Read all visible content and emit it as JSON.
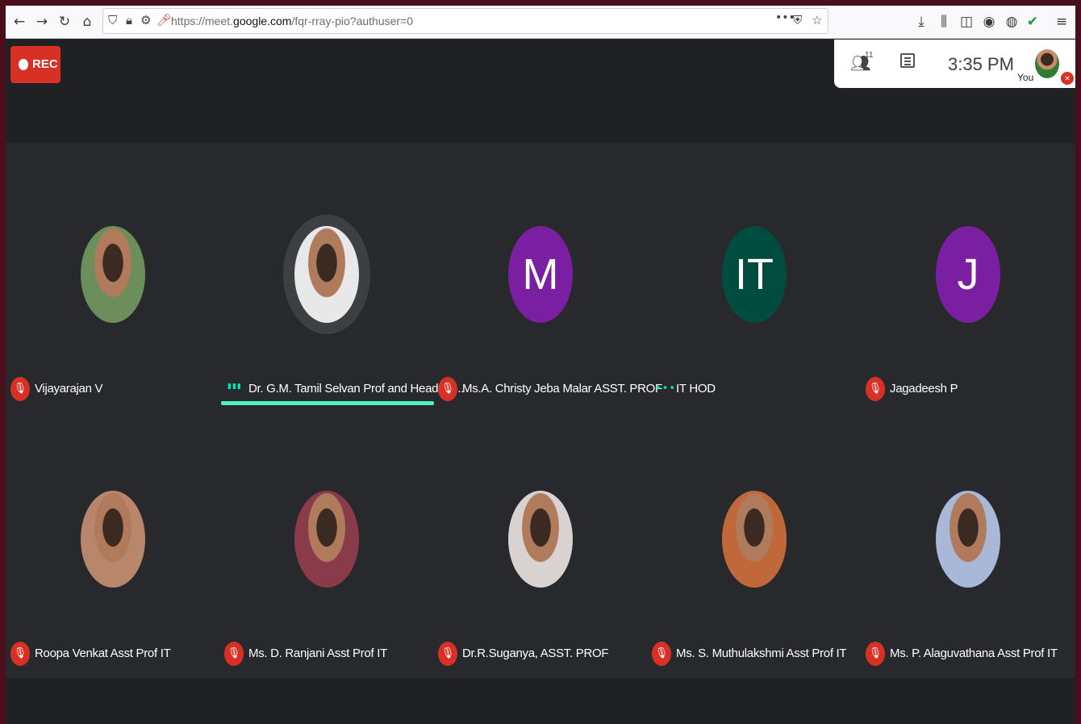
{
  "browser": {
    "url_prefix": "https://meet.",
    "url_domain": "google.com",
    "url_path": "/fqr-rray-pio?authuser=0",
    "url_more": "•••"
  },
  "meeting": {
    "rec_label": "REC",
    "people_count": "11",
    "clock": "3:35 PM",
    "you_label": "You"
  },
  "participants": [
    {
      "name": "Vijayarajan V",
      "muted": true,
      "avatar_type": "photo",
      "color": "#6b8e5a"
    },
    {
      "name": "Dr. G.M. Tamil Selvan Prof and Head IT ...",
      "muted": false,
      "speaking": true,
      "avatar_type": "photo",
      "color": "#e8e8e8"
    },
    {
      "name": "Ms.A. Christy Jeba Malar ASST. PROF",
      "muted": true,
      "avatar_type": "initial",
      "initial": "M",
      "color": "#7b1fa2"
    },
    {
      "name": "IT HOD",
      "muted": false,
      "avatar_type": "initial",
      "initial": "IT",
      "color": "#004d40"
    },
    {
      "name": "Jagadeesh P",
      "muted": true,
      "avatar_type": "initial",
      "initial": "J",
      "color": "#7b1fa2"
    },
    {
      "name": "Roopa Venkat Asst Prof IT",
      "muted": true,
      "avatar_type": "photo",
      "color": "#b9866b"
    },
    {
      "name": "Ms. D. Ranjani Asst Prof IT",
      "muted": true,
      "avatar_type": "photo",
      "color": "#8a3b4a"
    },
    {
      "name": "Dr.R.Suganya, ASST. PROF",
      "muted": true,
      "avatar_type": "photo",
      "color": "#d8d3d0"
    },
    {
      "name": "Ms. S. Muthulakshmi Asst Prof IT",
      "muted": true,
      "avatar_type": "photo",
      "color": "#c0683a"
    },
    {
      "name": "Ms. P. Alaguvathana Asst Prof IT",
      "muted": true,
      "avatar_type": "photo",
      "color": "#a9b8d8"
    }
  ]
}
